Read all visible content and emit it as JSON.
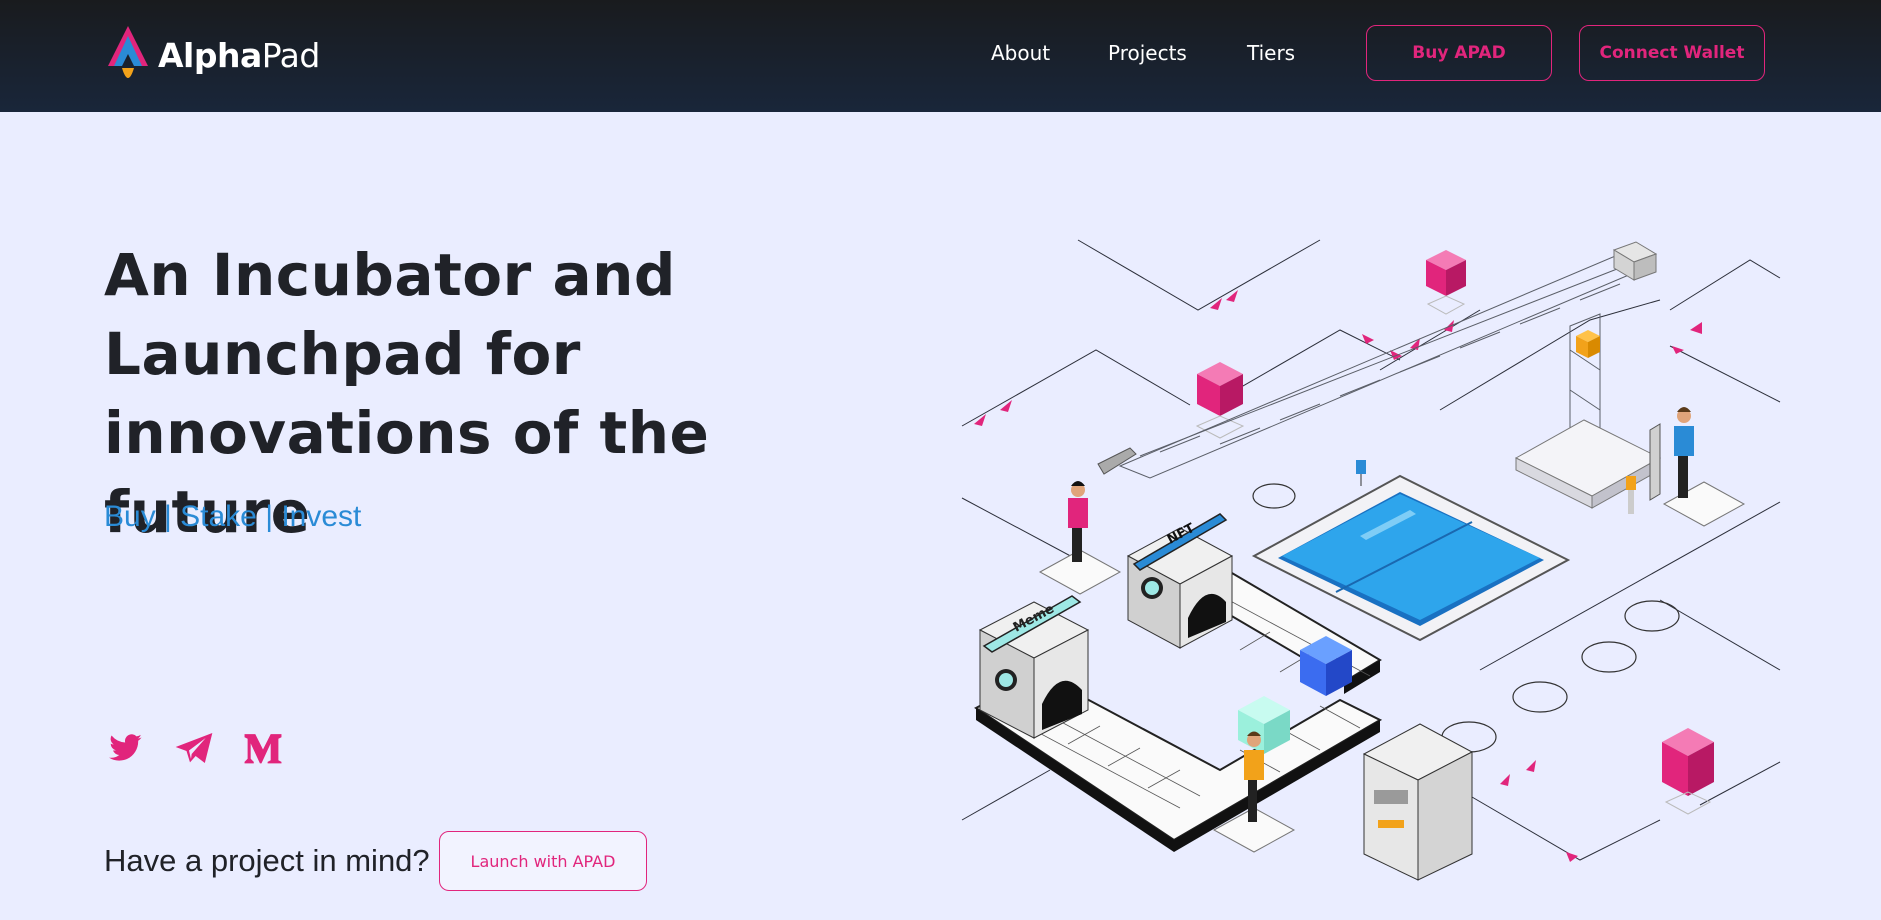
{
  "header": {
    "logo": {
      "bold": "Alpha",
      "light": "Pad"
    },
    "nav": [
      {
        "label": "About"
      },
      {
        "label": "Projects"
      },
      {
        "label": "Tiers"
      }
    ],
    "buy_label": "Buy APAD",
    "connect_label": "Connect Wallet"
  },
  "hero": {
    "title_lines": [
      "An Incubator and",
      "Launchpad for",
      "innovations of the future"
    ],
    "tagline": "Buy | Stake | Invest"
  },
  "social": [
    {
      "icon": "twitter-icon"
    },
    {
      "icon": "telegram-icon"
    },
    {
      "icon": "medium-icon"
    }
  ],
  "cta": {
    "text": "Have a project in mind?",
    "button_label": "Launch with APAD"
  },
  "illustration": {
    "signs": [
      "NFT",
      "Meme"
    ]
  },
  "colors": {
    "accent": "#e1257c",
    "link": "#2a8bd6",
    "header_bg": "#19212c",
    "page_bg": "#eaedff",
    "text": "#202228"
  }
}
